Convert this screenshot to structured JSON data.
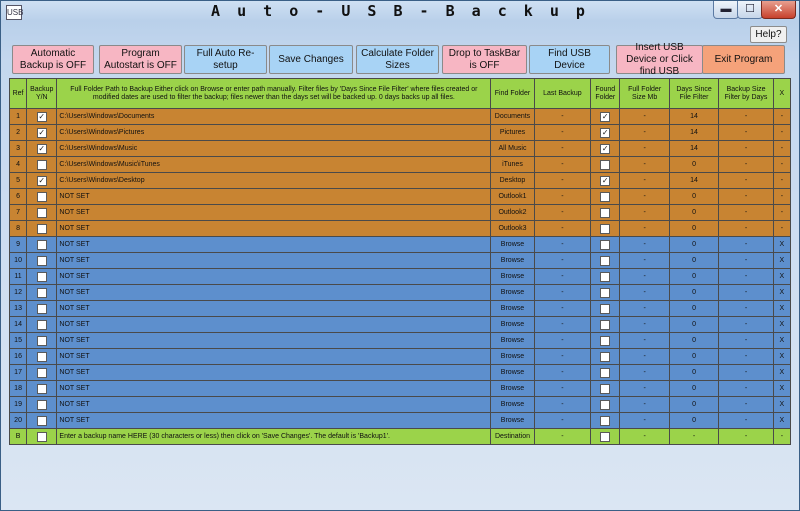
{
  "window": {
    "title": "A u t o - U S B - B a c k u p",
    "icon_glyph": "USB",
    "minimize_label": "▬",
    "maximize_label": "☐",
    "close_label": "✕"
  },
  "help_label": "Help?",
  "toolbar": [
    {
      "name": "automatic-backup-button",
      "label": "Automatic Backup is OFF",
      "color": "pink"
    },
    {
      "name": "program-autostart-button",
      "label": "Program Autostart is OFF",
      "color": "pink"
    },
    {
      "name": "full-auto-resetup-button",
      "label": "Full Auto Re-setup",
      "color": "blue"
    },
    {
      "name": "save-changes-button",
      "label": "Save Changes",
      "color": "blue"
    },
    {
      "name": "calculate-folder-sizes-button",
      "label": "Calculate Folder Sizes",
      "color": "blue"
    },
    {
      "name": "drop-to-taskbar-button",
      "label": "Drop to TaskBar is OFF",
      "color": "pink"
    },
    {
      "name": "find-usb-device-button",
      "label": "Find USB Device",
      "color": "blue"
    },
    {
      "name": "insert-usb-device-button",
      "label": "Insert USB Device or Click find USB",
      "color": "pink"
    },
    {
      "name": "exit-program-button",
      "label": "Exit Program",
      "color": "orange"
    }
  ],
  "headers": {
    "ref": "Ref",
    "backup": "Backup Y/N",
    "path": "Full Folder Path to Backup Either click on Browse or enter path manually. Filter files by 'Days Since File Filter' where files created or modified dates are used to filter the backup; files newer than the days set will be backed up. 0 days backs up all files.",
    "find": "Find Folder",
    "last": "Last Backup",
    "found": "Found Folder",
    "size": "Full Folder Size Mb",
    "days": "Days Since File Filter",
    "filtered": "Backup Size Filter by Days",
    "x": "X"
  },
  "rows": [
    {
      "ref": "1",
      "checked": true,
      "path": "C:\\Users\\Windows\\Documents",
      "find": "Documents",
      "last": "-",
      "found": true,
      "size": "-",
      "days": "14",
      "filtered": "-",
      "x": "-",
      "group": "orange"
    },
    {
      "ref": "2",
      "checked": true,
      "path": "C:\\Users\\Windows\\Pictures",
      "find": "Pictures",
      "last": "-",
      "found": true,
      "size": "-",
      "days": "14",
      "filtered": "-",
      "x": "-",
      "group": "orange"
    },
    {
      "ref": "3",
      "checked": true,
      "path": "C:\\Users\\Windows\\Music",
      "find": "All Music",
      "last": "-",
      "found": true,
      "size": "-",
      "days": "14",
      "filtered": "-",
      "x": "-",
      "group": "orange"
    },
    {
      "ref": "4",
      "checked": false,
      "path": "C:\\Users\\Windows\\Music\\iTunes",
      "find": "iTunes",
      "last": "-",
      "found": false,
      "size": "-",
      "days": "0",
      "filtered": "-",
      "x": "-",
      "group": "orange"
    },
    {
      "ref": "5",
      "checked": true,
      "path": "C:\\Users\\Windows\\Desktop",
      "find": "Desktop",
      "last": "-",
      "found": true,
      "size": "-",
      "days": "14",
      "filtered": "-",
      "x": "-",
      "group": "orange"
    },
    {
      "ref": "6",
      "checked": false,
      "path": "NOT SET",
      "find": "Outlook1",
      "last": "-",
      "found": false,
      "size": "-",
      "days": "0",
      "filtered": "-",
      "x": "-",
      "group": "orange"
    },
    {
      "ref": "7",
      "checked": false,
      "path": "NOT SET",
      "find": "Outlook2",
      "last": "-",
      "found": false,
      "size": "-",
      "days": "0",
      "filtered": "-",
      "x": "-",
      "group": "orange"
    },
    {
      "ref": "8",
      "checked": false,
      "path": "NOT SET",
      "find": "Outlook3",
      "last": "-",
      "found": false,
      "size": "-",
      "days": "0",
      "filtered": "-",
      "x": "-",
      "group": "orange"
    },
    {
      "ref": "9",
      "checked": false,
      "path": "NOT SET",
      "find": "Browse",
      "last": "-",
      "found": false,
      "size": "-",
      "days": "0",
      "filtered": "-",
      "x": "X",
      "group": "blue"
    },
    {
      "ref": "10",
      "checked": false,
      "path": "NOT SET",
      "find": "Browse",
      "last": "-",
      "found": false,
      "size": "-",
      "days": "0",
      "filtered": "-",
      "x": "X",
      "group": "blue"
    },
    {
      "ref": "11",
      "checked": false,
      "path": "NOT SET",
      "find": "Browse",
      "last": "-",
      "found": false,
      "size": "-",
      "days": "0",
      "filtered": "-",
      "x": "X",
      "group": "blue"
    },
    {
      "ref": "12",
      "checked": false,
      "path": "NOT SET",
      "find": "Browse",
      "last": "-",
      "found": false,
      "size": "-",
      "days": "0",
      "filtered": "-",
      "x": "X",
      "group": "blue"
    },
    {
      "ref": "13",
      "checked": false,
      "path": "NOT SET",
      "find": "Browse",
      "last": "-",
      "found": false,
      "size": "-",
      "days": "0",
      "filtered": "-",
      "x": "X",
      "group": "blue"
    },
    {
      "ref": "14",
      "checked": false,
      "path": "NOT SET",
      "find": "Browse",
      "last": "-",
      "found": false,
      "size": "-",
      "days": "0",
      "filtered": "-",
      "x": "X",
      "group": "blue"
    },
    {
      "ref": "15",
      "checked": false,
      "path": "NOT SET",
      "find": "Browse",
      "last": "-",
      "found": false,
      "size": "-",
      "days": "0",
      "filtered": "-",
      "x": "X",
      "group": "blue"
    },
    {
      "ref": "16",
      "checked": false,
      "path": "NOT SET",
      "find": "Browse",
      "last": "-",
      "found": false,
      "size": "-",
      "days": "0",
      "filtered": "-",
      "x": "X",
      "group": "blue"
    },
    {
      "ref": "17",
      "checked": false,
      "path": "NOT SET",
      "find": "Browse",
      "last": "-",
      "found": false,
      "size": "-",
      "days": "0",
      "filtered": "-",
      "x": "X",
      "group": "blue"
    },
    {
      "ref": "18",
      "checked": false,
      "path": "NOT SET",
      "find": "Browse",
      "last": "-",
      "found": false,
      "size": "-",
      "days": "0",
      "filtered": "-",
      "x": "X",
      "group": "blue"
    },
    {
      "ref": "19",
      "checked": false,
      "path": "NOT SET",
      "find": "Browse",
      "last": "-",
      "found": false,
      "size": "-",
      "days": "0",
      "filtered": "-",
      "x": "X",
      "group": "blue"
    },
    {
      "ref": "20",
      "checked": false,
      "path": "NOT SET",
      "find": "Browse",
      "last": "-",
      "found": false,
      "size": "-",
      "days": "0",
      "filtered": "-",
      "x": "X",
      "group": "blue"
    },
    {
      "ref": "B",
      "checked": false,
      "path": "Enter a backup name HERE (30 characters or less) then click on 'Save Changes'. The default is 'Backup1'.",
      "find": "Destination",
      "last": "-",
      "found": false,
      "size": "-",
      "days": "-",
      "filtered": "-",
      "x": "-",
      "group": "dest"
    }
  ],
  "colors": {
    "header_green": "#9bd34a",
    "row_orange": "#c88432",
    "row_blue": "#5d8fcd",
    "button_pink": "#f7b6c3",
    "button_blue": "#a8d3f5",
    "button_orange": "#f5a27a"
  }
}
